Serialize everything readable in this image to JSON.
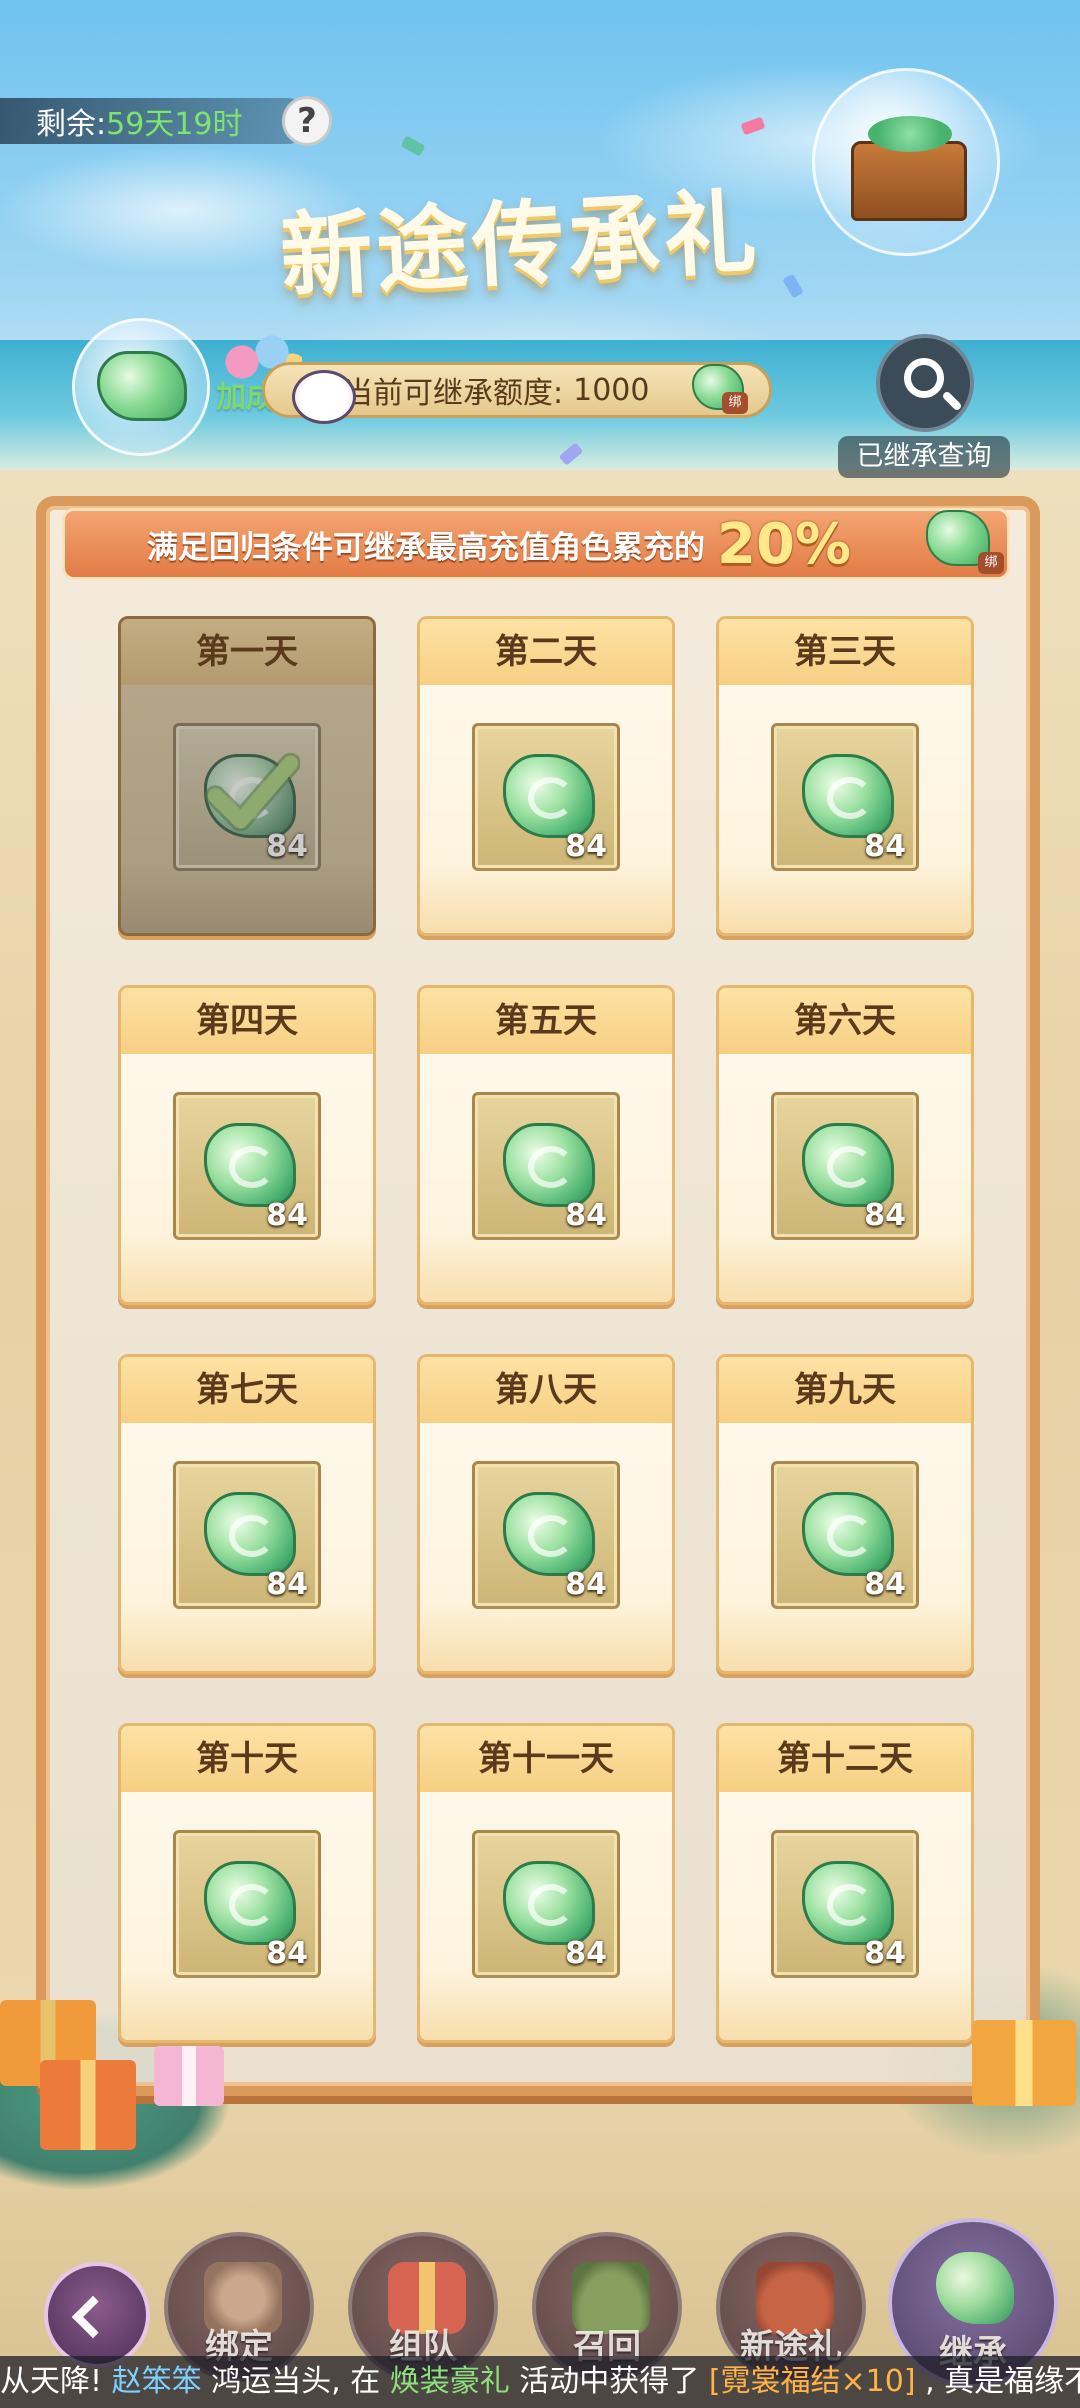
{
  "timer": {
    "label": "剩余:",
    "value": "59天19时"
  },
  "help": {
    "symbol": "?"
  },
  "title": "新途传承礼",
  "bonus": {
    "label": "加成"
  },
  "quota": {
    "label": "当前可继承额度:",
    "value": "1000",
    "bind_tag": "绑"
  },
  "query": {
    "label": "已继承查询"
  },
  "banner": {
    "text": "满足回归条件可继承最高充值角色累充的",
    "percent": "20%",
    "bind_tag": "绑"
  },
  "days": [
    {
      "label": "第一天",
      "qty": "84",
      "claimed": true
    },
    {
      "label": "第二天",
      "qty": "84",
      "claimed": false
    },
    {
      "label": "第三天",
      "qty": "84",
      "claimed": false
    },
    {
      "label": "第四天",
      "qty": "84",
      "claimed": false
    },
    {
      "label": "第五天",
      "qty": "84",
      "claimed": false
    },
    {
      "label": "第六天",
      "qty": "84",
      "claimed": false
    },
    {
      "label": "第七天",
      "qty": "84",
      "claimed": false
    },
    {
      "label": "第八天",
      "qty": "84",
      "claimed": false
    },
    {
      "label": "第九天",
      "qty": "84",
      "claimed": false
    },
    {
      "label": "第十天",
      "qty": "84",
      "claimed": false
    },
    {
      "label": "第十一天",
      "qty": "84",
      "claimed": false
    },
    {
      "label": "第十二天",
      "qty": "84",
      "claimed": false
    }
  ],
  "nav": [
    {
      "label": "绑定",
      "icon": "fist-icon"
    },
    {
      "label": "组队",
      "icon": "gift-box-icon"
    },
    {
      "label": "召回",
      "icon": "mountain-icon"
    },
    {
      "label": "新途礼",
      "icon": "money-bag-icon"
    },
    {
      "label": "继承",
      "icon": "jade-icon",
      "active": true
    }
  ],
  "ticker": {
    "p1": "从天降!",
    "name": "赵笨笨",
    "p2": "鸿运当头, 在",
    "event": "焕装豪礼",
    "p3": "活动中获得了",
    "item": "[霓裳福结×10]",
    "p4": ", 真是福缘不浅"
  },
  "colors": {
    "accent_green": "#7de56a",
    "banner_orange": "#e27b46",
    "card_border": "#e7b66f",
    "jade_green": "#4fb573"
  }
}
